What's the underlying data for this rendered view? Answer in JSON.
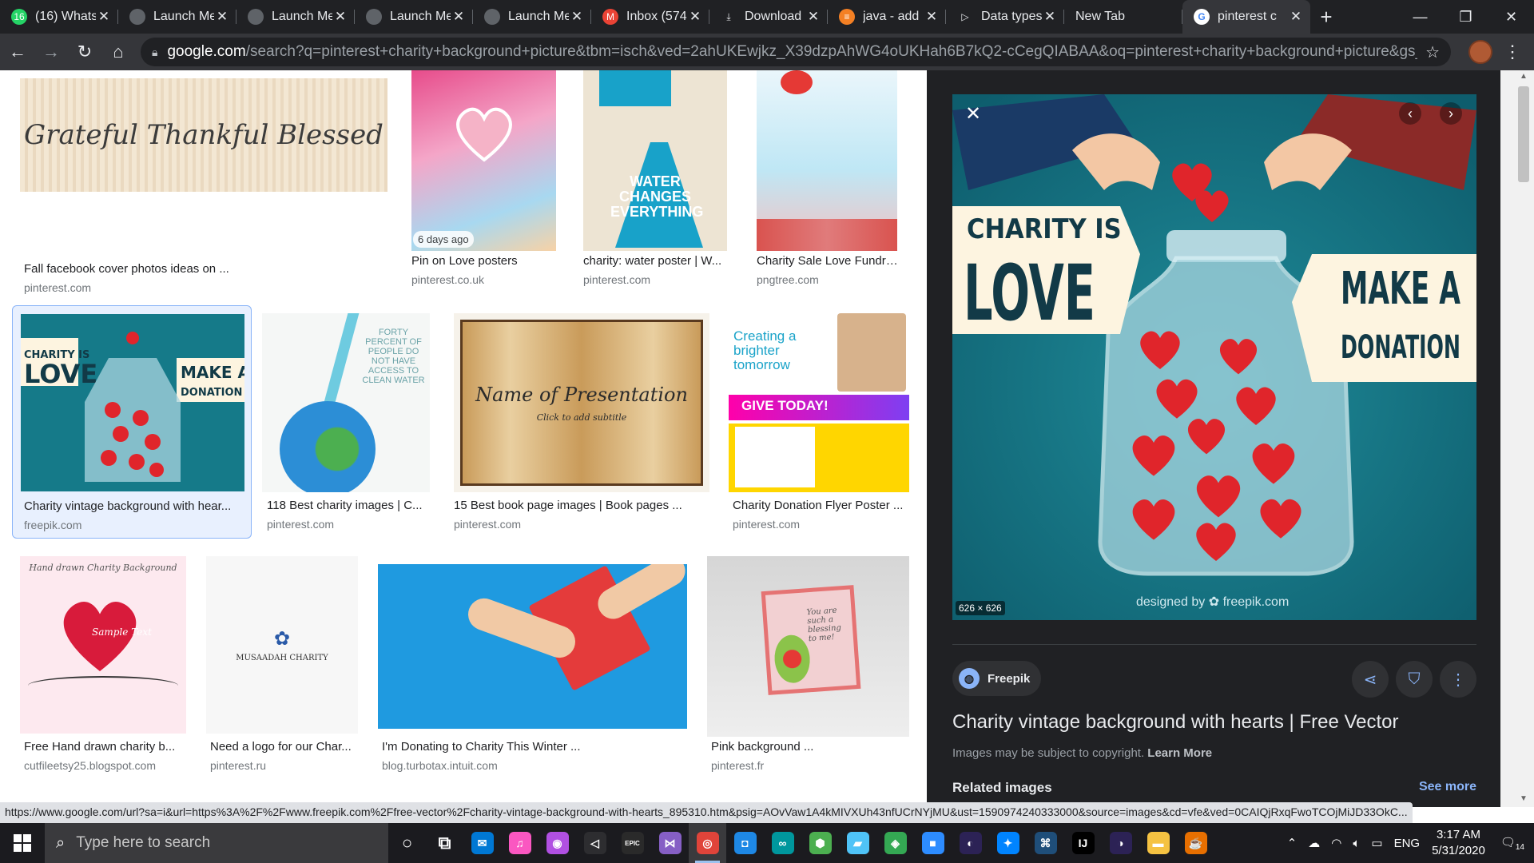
{
  "browser": {
    "tabs": [
      {
        "title": "(16) Whats",
        "favicon": "whatsapp-icon",
        "color": "#25d366",
        "glyph": "16"
      },
      {
        "title": "Launch Me",
        "favicon": "globe-icon",
        "color": "#5f6368",
        "glyph": ""
      },
      {
        "title": "Launch Me",
        "favicon": "globe-icon",
        "color": "#5f6368",
        "glyph": ""
      },
      {
        "title": "Launch Me",
        "favicon": "globe-icon",
        "color": "#5f6368",
        "glyph": ""
      },
      {
        "title": "Launch Me",
        "favicon": "globe-icon",
        "color": "#5f6368",
        "glyph": ""
      },
      {
        "title": "Inbox (574",
        "favicon": "gmail-icon",
        "color": "#ea4335",
        "glyph": "M"
      },
      {
        "title": "Download",
        "favicon": "download-icon",
        "color": "#35363a",
        "glyph": "⤓"
      },
      {
        "title": "java - add",
        "favicon": "stackoverflow-icon",
        "color": "#f48024",
        "glyph": "≡"
      },
      {
        "title": "Data types",
        "favicon": "play-icon",
        "color": "#e8eaed",
        "glyph": "▷"
      },
      {
        "title": "New Tab",
        "favicon": "",
        "color": "",
        "glyph": ""
      },
      {
        "title": "pinterest c",
        "favicon": "google-icon",
        "color": "#ffffff",
        "glyph": "G",
        "active": true
      }
    ],
    "new_tab": "+",
    "window": {
      "minimize": "—",
      "restore": "❐",
      "close": "✕"
    },
    "url_host": "google.com",
    "url_rest": "/search?q=pinterest+charity+background+picture&tbm=isch&ved=2ahUKEwjkz_X39dzpAhWG4oUKHah6B7kQ2-cCegQIABAA&oq=pinterest+charity+background+picture&gs_lcp=CgNp..."
  },
  "results": [
    {
      "title": "Fall facebook cover photos ideas on ...",
      "source": "pinterest.com",
      "art": "grateful",
      "caption": "Grateful Thankful Blessed"
    },
    {
      "title": "Pin on Love posters",
      "source": "pinterest.co.uk",
      "art": "heart-pink",
      "badge": "6 days ago"
    },
    {
      "title": "charity: water poster | W...",
      "source": "pinterest.com",
      "art": "water",
      "caption": "WATER CHANGES EVERYTHING"
    },
    {
      "title": "Charity Sale Love Fundrai...",
      "source": "pngtree.com",
      "art": "sale"
    },
    {
      "title": "Charity vintage background with hear...",
      "source": "freepik.com",
      "art": "jar-small",
      "selected": true
    },
    {
      "title": "118 Best charity images | C...",
      "source": "pinterest.com",
      "art": "earth",
      "caption": "FORTY PERCENT OF PEOPLE DO NOT HAVE ACCESS TO CLEAN WATER"
    },
    {
      "title": "15 Best book page images | Book pages ...",
      "source": "pinterest.com",
      "art": "book",
      "caption": "Name of Presentation",
      "subcaption": "Click to add subtitle"
    },
    {
      "title": "Charity Donation Flyer Poster ...",
      "source": "pinterest.com",
      "art": "flyer",
      "caption": "Creating a brighter tomorrow",
      "subcaption": "GIVE TODAY!"
    },
    {
      "title": "Free Hand drawn charity b...",
      "source": "cutfileetsy25.blogspot.com",
      "art": "hands-heart",
      "caption": "Hand drawn Charity Background",
      "subcaption": "Sample Text"
    },
    {
      "title": "Need a logo for our Char...",
      "source": "pinterest.ru",
      "art": "logo",
      "caption": "MUSAADAH CHARITY"
    },
    {
      "title": "I'm Donating to Charity This Winter ...",
      "source": "blog.turbotax.intuit.com",
      "art": "gift"
    },
    {
      "title": "Pink background ...",
      "source": "pinterest.fr",
      "art": "frame",
      "caption": "You are such a blessing to me!"
    }
  ],
  "preview": {
    "close": "✕",
    "prev": "‹",
    "next": "›",
    "dimensions": "626 × 626",
    "left_small": "CHARITY IS",
    "left_big": "LOVE",
    "right_top": "MAKE A",
    "right_bottom": "DONATION",
    "watermark": "designed by ✿ freepik.com",
    "source_name": "Freepik",
    "title": "Charity vintage background with hearts | Free Vector",
    "copyright": "Images may be subject to copyright.",
    "learn_more": "Learn More",
    "related": "Related images",
    "see_more": "See more"
  },
  "status_url": "https://www.google.com/url?sa=i&url=https%3A%2F%2Fwww.freepik.com%2Ffree-vector%2Fcharity-vintage-background-with-hearts_895310.htm&psig=AOvVaw1A4kMIVXUh43nfUCrNYjMU&ust=1590974240333000&source=images&cd=vfe&ved=0CAIQjRxqFwoTCOjMiJD33OkC...",
  "taskbar": {
    "search_placeholder": "Type here to search",
    "apps": [
      {
        "name": "cortana-icon",
        "glyph": "○",
        "color": "transparent"
      },
      {
        "name": "task-view-icon",
        "glyph": "⧉",
        "color": "transparent"
      },
      {
        "name": "mail-icon",
        "glyph": "✉",
        "color": "#0078d4"
      },
      {
        "name": "itunes-icon",
        "glyph": "♫",
        "color": "#fa57c1"
      },
      {
        "name": "podcast-icon",
        "glyph": "◉",
        "color": "#b150e2"
      },
      {
        "name": "visual-studio-code-icon",
        "glyph": "◁",
        "color": "#2d2d30"
      },
      {
        "name": "epic-games-icon",
        "glyph": "EPIC",
        "color": "#2a2a2a"
      },
      {
        "name": "visual-studio-icon",
        "glyph": "⋈",
        "color": "#865fc5"
      },
      {
        "name": "chrome-icon",
        "glyph": "◎",
        "color": "#e0443a",
        "running": true,
        "active": true
      },
      {
        "name": "instagram-icon",
        "glyph": "◘",
        "color": "#1e88e5"
      },
      {
        "name": "arduino-icon",
        "glyph": "∞",
        "color": "#00979d"
      },
      {
        "name": "cube-icon",
        "glyph": "⬢",
        "color": "#4caf50"
      },
      {
        "name": "notes-icon",
        "glyph": "▰",
        "color": "#4fc3f7"
      },
      {
        "name": "maps-icon",
        "glyph": "◈",
        "color": "#34a853"
      },
      {
        "name": "zoom-icon",
        "glyph": "■",
        "color": "#2d8cff"
      },
      {
        "name": "eclipse-icon",
        "glyph": "◐",
        "color": "#2c2255"
      },
      {
        "name": "messenger-icon",
        "glyph": "✦",
        "color": "#0084ff"
      },
      {
        "name": "code-editor-icon",
        "glyph": "⌘",
        "color": "#1f4e79"
      },
      {
        "name": "intellij-icon",
        "glyph": "IJ",
        "color": "#000000"
      },
      {
        "name": "eclipse-2-icon",
        "glyph": "◑",
        "color": "#2c2255"
      },
      {
        "name": "file-explorer-icon",
        "glyph": "▬",
        "color": "#f5c242"
      },
      {
        "name": "java-icon",
        "glyph": "☕",
        "color": "#e76f00"
      }
    ],
    "language": "ENG",
    "time": "3:17 AM",
    "date": "5/31/2020",
    "notifications": "14"
  }
}
